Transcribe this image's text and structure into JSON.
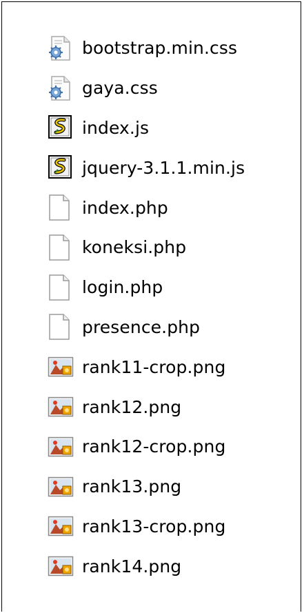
{
  "files": [
    {
      "name": "bootstrap.min.css",
      "icon": "css-file-icon"
    },
    {
      "name": "gaya.css",
      "icon": "css-file-icon"
    },
    {
      "name": "index.js",
      "icon": "js-script-icon"
    },
    {
      "name": "jquery-3.1.1.min.js",
      "icon": "js-script-icon"
    },
    {
      "name": "index.php",
      "icon": "blank-file-icon"
    },
    {
      "name": "koneksi.php",
      "icon": "blank-file-icon"
    },
    {
      "name": "login.php",
      "icon": "blank-file-icon"
    },
    {
      "name": "presence.php",
      "icon": "blank-file-icon"
    },
    {
      "name": "rank11-crop.png",
      "icon": "png-image-icon"
    },
    {
      "name": "rank12.png",
      "icon": "png-image-icon"
    },
    {
      "name": "rank12-crop.png",
      "icon": "png-image-icon"
    },
    {
      "name": "rank13.png",
      "icon": "png-image-icon"
    },
    {
      "name": "rank13-crop.png",
      "icon": "png-image-icon"
    },
    {
      "name": "rank14.png",
      "icon": "png-image-icon"
    }
  ]
}
